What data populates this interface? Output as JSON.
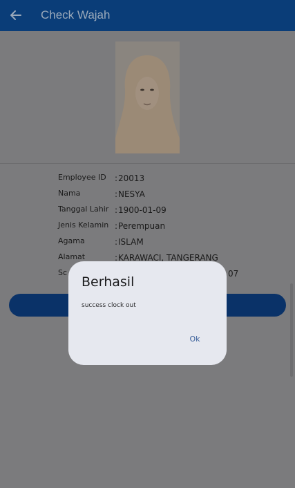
{
  "app_bar": {
    "title": "Check Wajah",
    "back_icon": "arrow-left-icon"
  },
  "employee": {
    "photo_label": "employee face photo",
    "fields": [
      {
        "label": "Employee ID",
        "value": "20013"
      },
      {
        "label": "Nama",
        "value": "NESYA"
      },
      {
        "label": "Tanggal Lahir",
        "value": "1900-01-09"
      },
      {
        "label": "Jenis Kelamin",
        "value": "Perempuan"
      },
      {
        "label": "Agama",
        "value": "ISLAM"
      },
      {
        "label": "Alamat",
        "value": "KARAWACI, TANGERANG"
      },
      {
        "label": "Sc",
        "value": "07"
      }
    ]
  },
  "dialog": {
    "title": "Berhasil",
    "message": "success clock out",
    "ok_label": "Ok"
  },
  "colors": {
    "app_bar": "#0a3d78",
    "scrim": "#7b7b7d",
    "dialog_bg": "#e6e8ef",
    "accent": "#3a5f9a"
  }
}
